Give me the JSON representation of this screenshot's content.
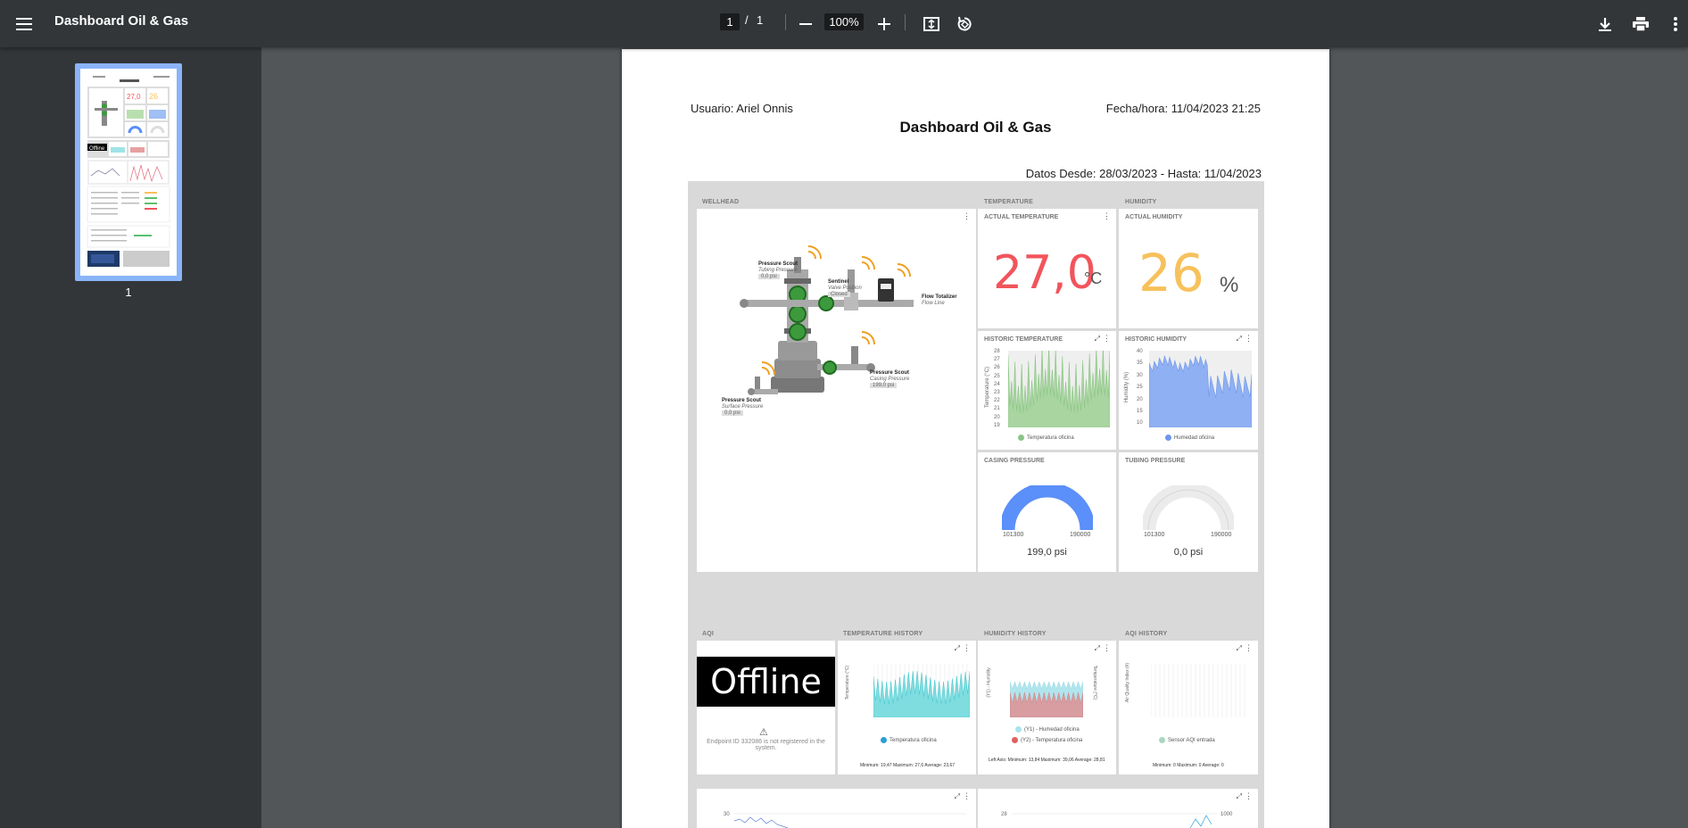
{
  "toolbar": {
    "title": "Dashboard Oil & Gas",
    "page_current": "1",
    "page_separator": "/",
    "page_total": "1",
    "zoom": "100%"
  },
  "sidebar": {
    "thumbnail_label": "1"
  },
  "report": {
    "user": "Usuario: Ariel Onnis",
    "datetime": "Fecha/hora: 11/04/2023 21:25",
    "title": "Dashboard Oil & Gas",
    "range": "Datos Desde: 28/03/2023 - Hasta: 11/04/2023"
  },
  "sections": {
    "wellhead": "WELLHEAD",
    "temperature": "TEMPERATURE",
    "humidity": "HUMIDITY",
    "aqi": "AQI",
    "temperature_history": "TEMPERATURE HISTORY",
    "humidity_history": "HUMIDITY HISTORY",
    "aqi_history": "AQI HISTORY"
  },
  "wellhead": {
    "scout1_title": "Pressure Scout",
    "scout1_sub": "Tubing Pressure",
    "scout1_val": "0,0 psi",
    "sentinel_title": "Sentinel",
    "sentinel_sub": "Valve Position",
    "sentinel_val": "Closed",
    "flow_title": "Flow Totalizer",
    "flow_sub": "Flow Line",
    "scout2_title": "Pressure Scout",
    "scout2_sub": "Casing Pressure",
    "scout2_val": "199,0 psi",
    "scout3_title": "Pressure Scout",
    "scout3_sub": "Surface Pressure",
    "scout3_val": "0,0 psi"
  },
  "actual_temperature": {
    "title": "ACTUAL TEMPERATURE",
    "value": "27,0",
    "unit": "°C"
  },
  "actual_humidity": {
    "title": "ACTUAL HUMIDITY",
    "value": "26",
    "unit": "%"
  },
  "historic_temperature": {
    "title": "HISTORIC TEMPERATURE",
    "ylabel": "Temperature (°C)",
    "ticks": [
      "28",
      "27",
      "26",
      "25",
      "24",
      "23",
      "22",
      "21",
      "20",
      "19"
    ],
    "legend": "Temperatura oficina",
    "color": "#a8d5a0"
  },
  "historic_humidity": {
    "title": "HISTORIC HUMIDITY",
    "ylabel": "Humidity (%)",
    "ticks": [
      "40",
      "35",
      "30",
      "25",
      "20",
      "15",
      "10"
    ],
    "legend": "Humedad oficina",
    "color": "#8fb0f2"
  },
  "casing_pressure": {
    "title": "CASING PRESSURE",
    "min": "101300",
    "max": "190000",
    "value": "199,0 psi",
    "fill_fraction": 1.0,
    "color": "#5b8ff9"
  },
  "tubing_pressure": {
    "title": "TUBING PRESSURE",
    "min": "101300",
    "max": "190000",
    "value": "0,0 psi",
    "fill_fraction": 0.0,
    "color": "#e6e6e6"
  },
  "aqi_card": {
    "status": "Offline",
    "message": "Endpoint ID 332086 is not registered in the system."
  },
  "temperature_history": {
    "ylabel": "Temperature (°C)",
    "legend": "Temperatura oficina",
    "stats": "Minimum: 19,47  Maximum: 27,6  Average: 23,67",
    "color": "#7fdde0"
  },
  "humidity_history": {
    "ylabel_left": "(Y1) - Humidity",
    "ylabel_right": "Temperature (°C)",
    "legend1": "(Y1) - Humedad oficina",
    "legend2": "(Y2) - Temperatura oficina",
    "stats": "Left Axis: Minimum: 13,84  Maximum: 39,06  Average: 28,81",
    "color1": "#a9e3ec",
    "color2": "#e88080"
  },
  "aqi_history": {
    "ylabel": "Air Quality Index (#)",
    "legend": "Sensor AQI entrada",
    "stats": "Minimum: 0  Maximum: 0  Average: 0",
    "color": "#a8d8c0"
  },
  "bottom_charts": {
    "left_tick": "30",
    "right_tick_left": "28",
    "right_tick_right": "1000"
  }
}
